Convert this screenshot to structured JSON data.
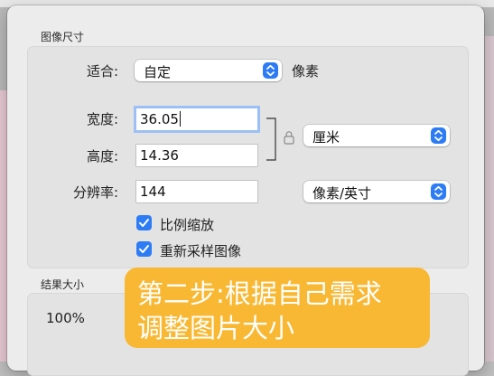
{
  "image_size": {
    "title": "图像尺寸",
    "fit": {
      "label": "适合:",
      "value": "自定",
      "unit": "像素"
    },
    "width": {
      "label": "宽度:",
      "value": "36.05"
    },
    "height": {
      "label": "高度:",
      "value": "14.36"
    },
    "unit_select": {
      "value": "厘米"
    },
    "resolution": {
      "label": "分辨率:",
      "value": "144",
      "unit": "像素/英寸"
    },
    "scale_proportionally": {
      "label": "比例缩放",
      "checked": true
    },
    "resample": {
      "label": "重新采样图像",
      "checked": true
    }
  },
  "result_size": {
    "title": "结果大小",
    "percent": "100%"
  },
  "callout": {
    "line1": "第二步:根据自己需求",
    "line2": "调整图片大小"
  },
  "colors": {
    "accent": "#2d7cf6",
    "callout_bg": "#f8b833"
  }
}
